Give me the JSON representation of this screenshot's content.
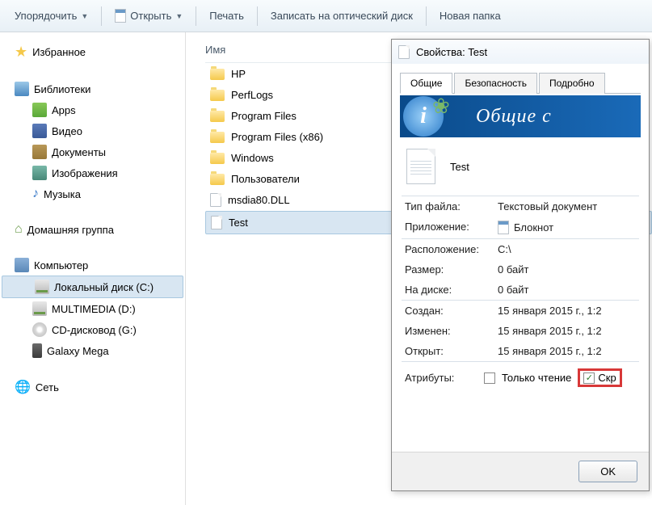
{
  "toolbar": {
    "organize": "Упорядочить",
    "open": "Открыть",
    "print": "Печать",
    "burn": "Записать на оптический диск",
    "new_folder": "Новая папка"
  },
  "sidebar": {
    "favorites": "Избранное",
    "libraries": "Библиотеки",
    "lib_items": [
      "Apps",
      "Видео",
      "Документы",
      "Изображения",
      "Музыка"
    ],
    "homegroup": "Домашняя группа",
    "computer": "Компьютер",
    "drives": [
      "Локальный диск (C:)",
      "MULTIMEDIA (D:)",
      "CD-дисковод (G:)",
      "Galaxy Mega"
    ],
    "network": "Сеть"
  },
  "content": {
    "header": "Имя",
    "items": [
      "HP",
      "PerfLogs",
      "Program Files",
      "Program Files (x86)",
      "Windows",
      "Пользователи",
      "msdia80.DLL",
      "Test"
    ]
  },
  "dialog": {
    "title": "Свойства: Test",
    "tabs": [
      "Общие",
      "Безопасность",
      "Подробно"
    ],
    "banner_text": "Общие с",
    "file_name": "Test",
    "rows": {
      "type_label": "Тип файла:",
      "type_value": "Текстовый документ",
      "app_label": "Приложение:",
      "app_value": "Блокнот",
      "loc_label": "Расположение:",
      "loc_value": "C:\\",
      "size_label": "Размер:",
      "size_value": "0 байт",
      "disk_label": "На диске:",
      "disk_value": "0 байт",
      "created_label": "Создан:",
      "created_value": "15 января 2015 г., 1:2",
      "modified_label": "Изменен:",
      "modified_value": "15 января 2015 г., 1:2",
      "opened_label": "Открыт:",
      "opened_value": "15 января 2015 г., 1:2",
      "attr_label": "Атрибуты:",
      "readonly": "Только чтение",
      "hidden": "Скр"
    },
    "ok": "OK"
  }
}
